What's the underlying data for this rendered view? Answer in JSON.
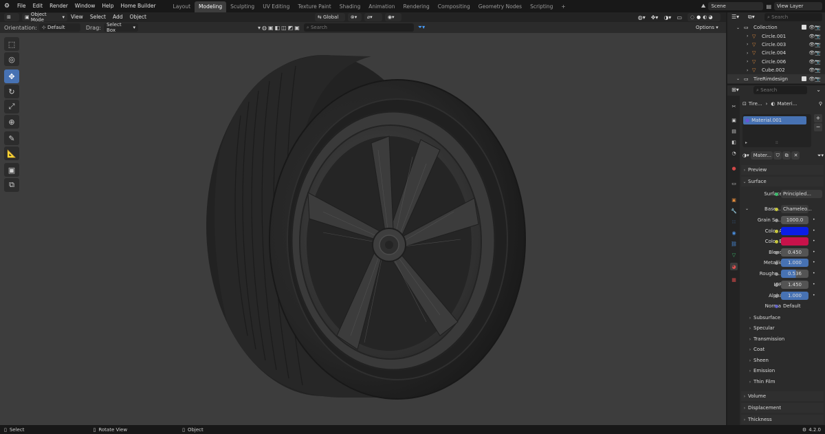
{
  "topbar": {
    "menus": [
      "File",
      "Edit",
      "Render",
      "Window",
      "Help",
      "Home Builder"
    ],
    "workspaces": [
      "Layout",
      "Modeling",
      "Sculpting",
      "UV Editing",
      "Texture Paint",
      "Shading",
      "Animation",
      "Rendering",
      "Compositing",
      "Geometry Nodes",
      "Scripting"
    ],
    "active_workspace": "Modeling",
    "add_tab": "+",
    "scene": "Scene",
    "view_layer": "View Layer"
  },
  "viewport_header": {
    "mode": "Object Mode",
    "menus": [
      "View",
      "Select",
      "Add",
      "Object"
    ],
    "transform": "Global"
  },
  "tool_settings": {
    "orientation_label": "Orientation:",
    "orientation_value": "Default",
    "drag_label": "Drag:",
    "drag_value": "Select Box",
    "search_placeholder": "Search",
    "options": "Options"
  },
  "outliner": {
    "search_placeholder": "Search",
    "items": [
      {
        "name": "Collection"
      },
      {
        "name": "Circle.001"
      },
      {
        "name": "Circle.003"
      },
      {
        "name": "Circle.004"
      },
      {
        "name": "Circle.006"
      },
      {
        "name": "Cube.002"
      },
      {
        "name": "TireRimdesign"
      }
    ]
  },
  "properties": {
    "search_placeholder": "Search",
    "breadcrumb_object": "Tire...",
    "breadcrumb_material": "Materi...",
    "material_slot": "Material.001",
    "material_name": "Mater...",
    "sections": {
      "preview": "Preview",
      "surface_panel": "Surface"
    },
    "surface_label": "Surface",
    "surface_value": "Principled...",
    "base_label": "Base ...",
    "base_value": "Chameleo...",
    "rows": [
      {
        "label": "Grain Sc...",
        "value": "1000.0"
      },
      {
        "label": "Color A",
        "value": ""
      },
      {
        "label": "Color B",
        "value": ""
      },
      {
        "label": "Blend",
        "value": "0.450"
      },
      {
        "label": "Metallic",
        "value": "1.000"
      },
      {
        "label": "Roughn...",
        "value": "0.536"
      },
      {
        "label": "IOR",
        "value": "1.450"
      },
      {
        "label": "Alpha",
        "value": "1.000"
      },
      {
        "label": "Normal",
        "value": "Default"
      }
    ],
    "subsections": [
      "Subsurface",
      "Specular",
      "Transmission",
      "Coat",
      "Sheen",
      "Emission",
      "Thin Film"
    ],
    "bottom_sections": [
      "Volume",
      "Displacement",
      "Thickness"
    ]
  },
  "colors": {
    "accent": "#4772b3",
    "color_a": "#0a1ee6",
    "color_b": "#c8124a",
    "metallic_fill": "#4772b3"
  },
  "statusbar": {
    "left": "Select",
    "middle": "Rotate View",
    "right": "Object",
    "version": "4.2.0"
  }
}
